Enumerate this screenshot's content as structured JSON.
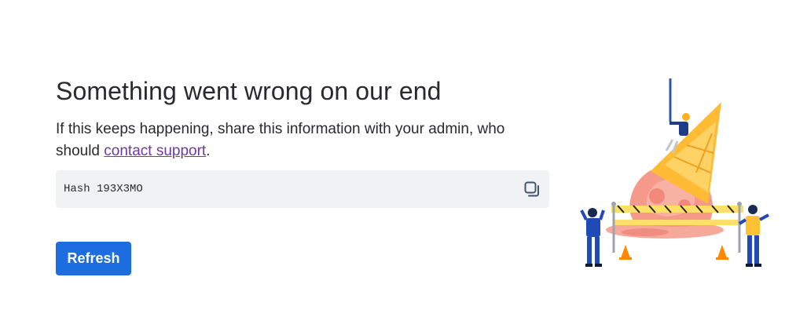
{
  "error": {
    "title": "Something went wrong on our end",
    "description_before": "If this keeps happening, share this information with your admin, who should ",
    "link_text": "contact support",
    "description_after": ".",
    "hash": "Hash 193X3MO",
    "refresh_label": "Refresh"
  },
  "icons": {
    "copy": "copy-icon",
    "illustration": "melted-ice-cream-illustration"
  },
  "colors": {
    "primary_button": "#1d6ce0",
    "link": "#6e3b9c",
    "hash_background": "#f1f2f4"
  }
}
